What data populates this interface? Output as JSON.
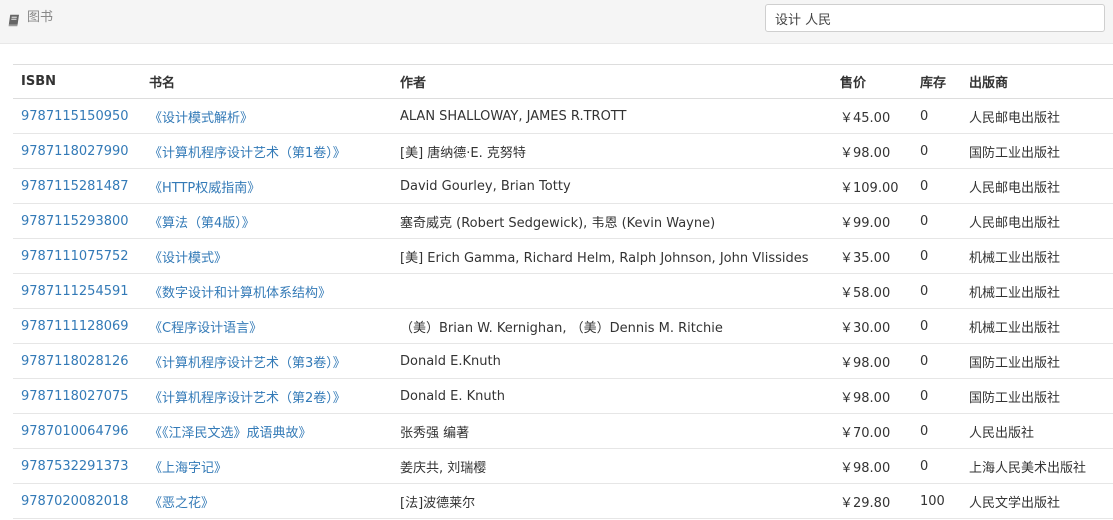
{
  "header": {
    "icon": "book-icon",
    "label": "图书",
    "search": {
      "value": "设计 人民",
      "placeholder": ""
    }
  },
  "colors": {
    "link": "#337ab7",
    "topbar_bg": "#f5f5f5"
  },
  "table": {
    "headers": [
      "ISBN",
      "书名",
      "作者",
      "售价",
      "库存",
      "出版商"
    ],
    "rows": [
      [
        "9787115150950",
        "《设计模式解析》",
        "ALAN SHALLOWAY, JAMES R.TROTT",
        "￥45.00",
        "0",
        "人民邮电出版社"
      ],
      [
        "9787118027990",
        "《计算机程序设计艺术（第1卷）》",
        "[美] 唐纳德·E. 克努特",
        "￥98.00",
        "0",
        "国防工业出版社"
      ],
      [
        "9787115281487",
        "《HTTP权威指南》",
        "David Gourley, Brian Totty",
        "￥109.00",
        "0",
        "人民邮电出版社"
      ],
      [
        "9787115293800",
        "《算法（第4版）》",
        "塞奇威克 (Robert Sedgewick), 韦恩 (Kevin Wayne)",
        "￥99.00",
        "0",
        "人民邮电出版社"
      ],
      [
        "9787111075752",
        "《设计模式》",
        "[美] Erich Gamma, Richard Helm, Ralph Johnson, John Vlissides",
        "￥35.00",
        "0",
        "机械工业出版社"
      ],
      [
        "9787111254591",
        "《数字设计和计算机体系结构》",
        "",
        "￥58.00",
        "0",
        "机械工业出版社"
      ],
      [
        "9787111128069",
        "《C程序设计语言》",
        "（美）Brian W. Kernighan, （美）Dennis M. Ritchie",
        "￥30.00",
        "0",
        "机械工业出版社"
      ],
      [
        "9787118028126",
        "《计算机程序设计艺术（第3卷）》",
        "Donald E.Knuth",
        "￥98.00",
        "0",
        "国防工业出版社"
      ],
      [
        "9787118027075",
        "《计算机程序设计艺术（第2卷）》",
        "Donald E. Knuth",
        "￥98.00",
        "0",
        "国防工业出版社"
      ],
      [
        "9787010064796",
        "《《江泽民文选》成语典故》",
        "张秀强 编著",
        "￥70.00",
        "0",
        "人民出版社"
      ],
      [
        "9787532291373",
        "《上海字记》",
        "姜庆共, 刘瑞樱",
        "￥98.00",
        "0",
        "上海人民美术出版社"
      ],
      [
        "9787020082018",
        "《恶之花》",
        "[法]波德莱尔",
        "￥29.80",
        "100",
        "人民文学出版社"
      ]
    ]
  }
}
